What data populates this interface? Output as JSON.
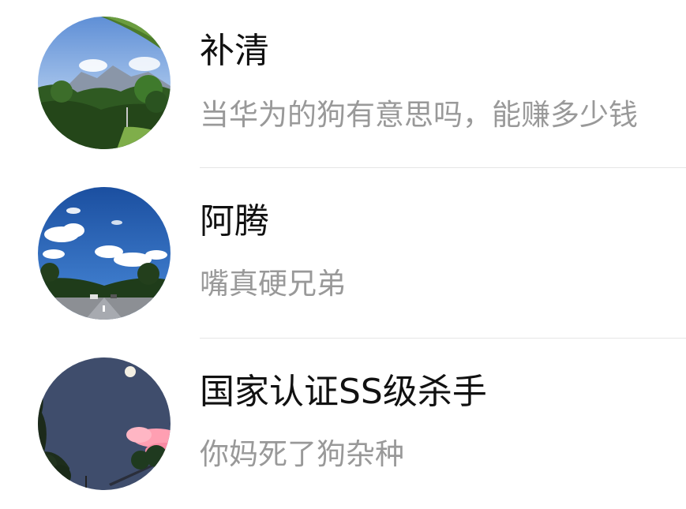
{
  "chats": [
    {
      "name": "补清",
      "preview": "当华为的狗有意思吗，能赚多少钱",
      "avatar": "mountain-forest-avatar"
    },
    {
      "name": "阿腾",
      "preview": "嘴真硬兄弟",
      "avatar": "blue-sky-road-avatar"
    },
    {
      "name": "国家认证SS级杀手",
      "preview": "你妈死了狗杂种",
      "avatar": "moon-night-sky-avatar"
    }
  ],
  "colors": {
    "name_text": "#111111",
    "preview_text": "#999999",
    "divider": "#e5e5e5",
    "background": "#ffffff"
  }
}
